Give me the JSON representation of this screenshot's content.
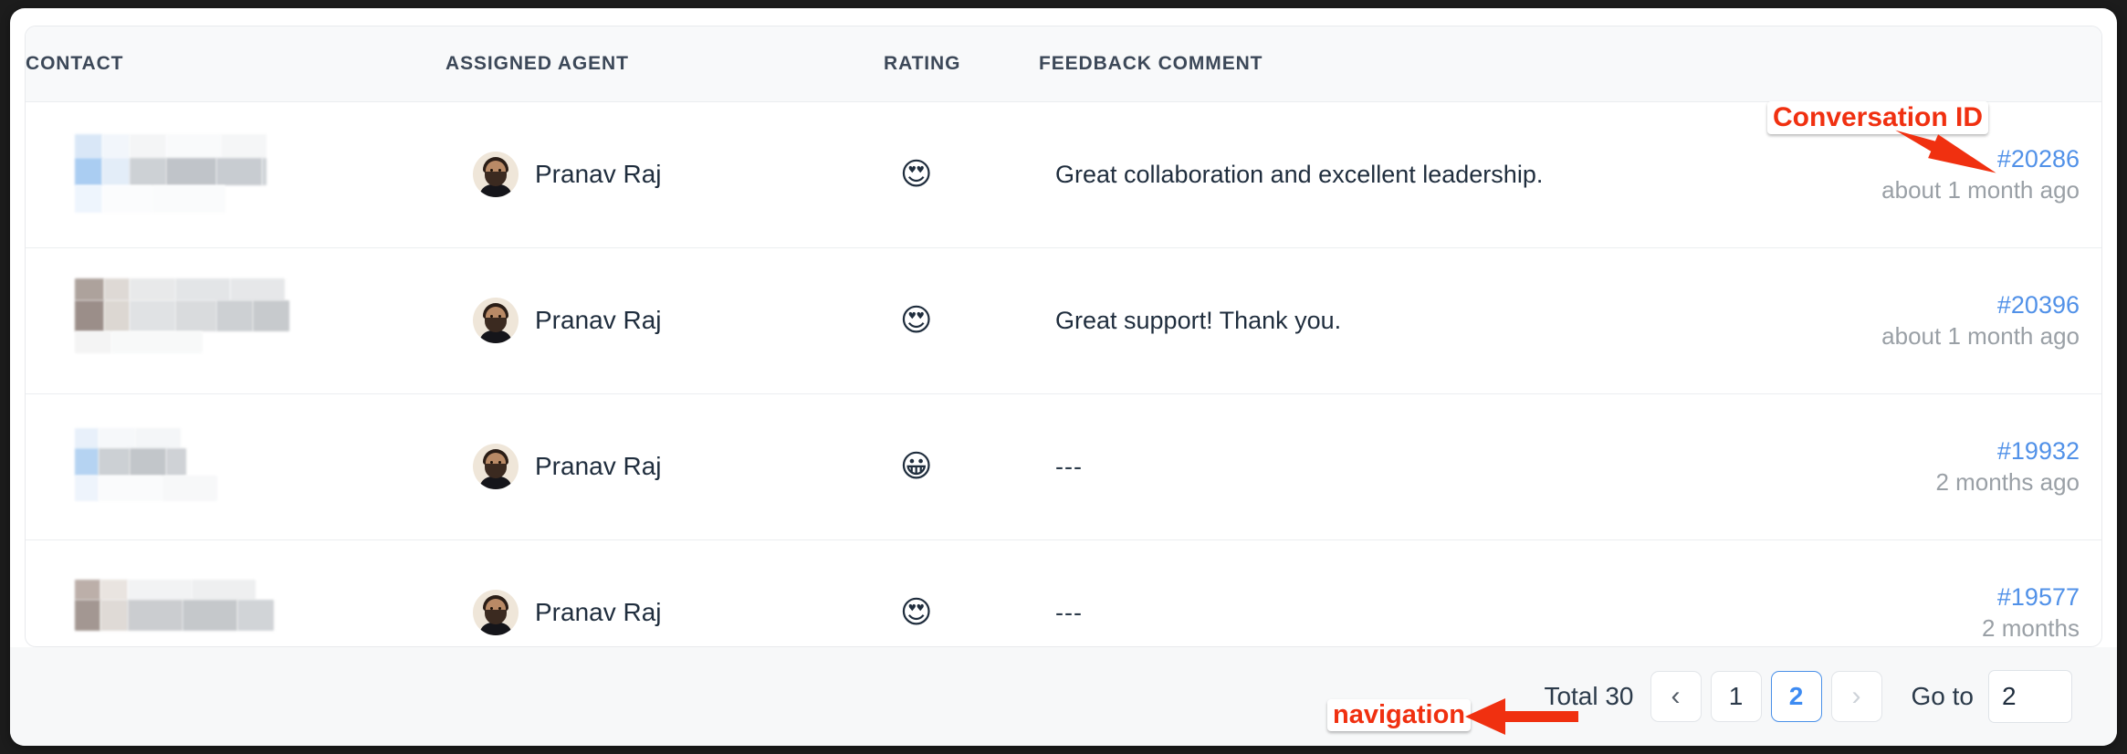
{
  "table": {
    "columns": [
      {
        "key": "contact",
        "label": "CONTACT"
      },
      {
        "key": "agent",
        "label": "ASSIGNED AGENT"
      },
      {
        "key": "rating",
        "label": "RATING"
      },
      {
        "key": "comment",
        "label": "FEEDBACK COMMENT"
      },
      {
        "key": "convid",
        "label": ""
      }
    ],
    "rows": [
      {
        "contact": "",
        "contact_state": "redacted",
        "agent": "Pranav Raj",
        "agent_avatar": "agent-avatar",
        "rating": "😍",
        "rating_name": "smiling-face-with-heart-eyes-emoji",
        "comment": "Great collaboration and excellent leadership.",
        "conversation_id": "#20286",
        "timestamp": "about 1 month ago"
      },
      {
        "contact": "",
        "contact_state": "redacted",
        "agent": "Pranav Raj",
        "agent_avatar": "agent-avatar",
        "rating": "😍",
        "rating_name": "smiling-face-with-heart-eyes-emoji",
        "comment": "Great support! Thank you.",
        "conversation_id": "#20396",
        "timestamp": "about 1 month ago"
      },
      {
        "contact": "",
        "contact_state": "redacted",
        "agent": "Pranav Raj",
        "agent_avatar": "agent-avatar",
        "rating": "😀",
        "rating_name": "grinning-face-emoji",
        "comment": "---",
        "conversation_id": "#19932",
        "timestamp": "2 months ago"
      },
      {
        "contact": "",
        "contact_state": "redacted",
        "agent": "Pranav Raj",
        "agent_avatar": "agent-avatar",
        "rating": "😍",
        "rating_name": "smiling-face-with-heart-eyes-emoji",
        "comment": "---",
        "conversation_id": "#19577",
        "timestamp": "2 months"
      }
    ]
  },
  "pagination": {
    "total_label": "Total 30",
    "prev_icon": "chevron-left-icon",
    "prev_glyph": "‹",
    "next_icon": "chevron-right-icon",
    "next_glyph": "›",
    "pages": [
      "1",
      "2"
    ],
    "active_page": "2",
    "goto_label": "Go to",
    "goto_value": "2"
  },
  "annotations": [
    {
      "id": "conversation-id",
      "label": "Conversation ID",
      "color": "#f03010"
    },
    {
      "id": "navigation",
      "label": "navigation",
      "color": "#f03010"
    }
  ],
  "colors": {
    "link": "#5191e8",
    "active_page": "#3d8bf2",
    "annotation": "#f03010",
    "muted_text": "#9aa0a6",
    "header_bg": "#f8f9fa",
    "footer_bg": "#f7f8f9"
  }
}
